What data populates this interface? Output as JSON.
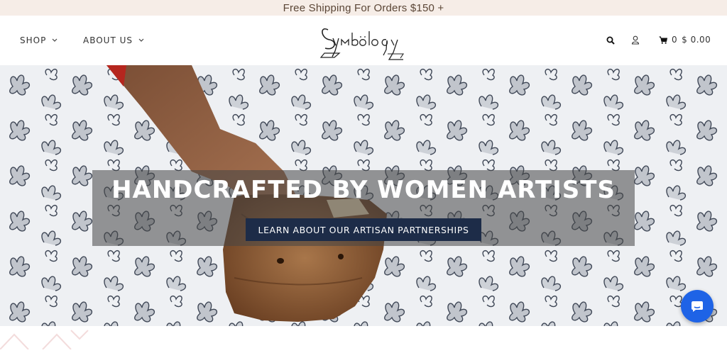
{
  "announcement": {
    "text": "Free Shipping For Orders $150 +"
  },
  "nav": {
    "shop": "SHOP",
    "about": "ABOUT US"
  },
  "logo": {
    "text": "Symbology"
  },
  "utility": {
    "icons": [
      "search-icon",
      "user-icon",
      "cart-icon"
    ],
    "cart_count": "0",
    "cart_total": "$ 0.00"
  },
  "hero": {
    "title": "HANDCRAFTED BY WOMEN ARTISTS",
    "button_label": "LEARN ABOUT OUR ARTISAN PARTNERSHIPS"
  },
  "colors": {
    "announcement_bg": "#f6ede7",
    "button_bg": "#1d2c48",
    "chat_bubble": "#1e63e6"
  }
}
